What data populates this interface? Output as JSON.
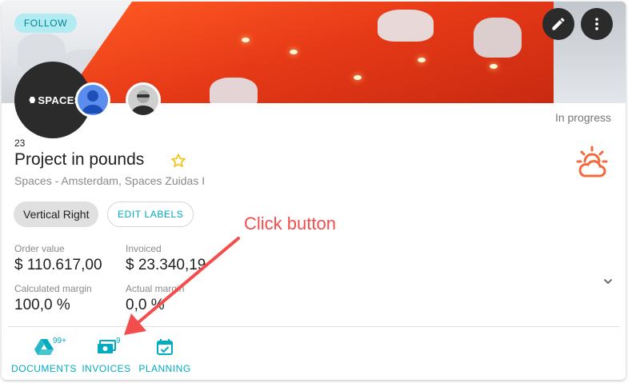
{
  "header": {
    "follow_label": "FOLLOW",
    "edit_icon": "pencil-icon",
    "more_icon": "more-vert-icon"
  },
  "logo": {
    "text": "SPACES"
  },
  "project": {
    "status": "In progress",
    "number": "23",
    "title": "Project in pounds",
    "subtitle": "Spaces - Amsterdam, Spaces Zuidas I",
    "favorite_icon": "star-outline-icon",
    "weather_icon": "sun-cloud-icon",
    "accent_color": "#f26a3d"
  },
  "labels": {
    "chip": "Vertical Right",
    "edit_label": "EDIT LABELS"
  },
  "metrics": {
    "order_value_label": "Order value",
    "order_value": "$ 110.617,00",
    "invoiced_label": "Invoiced",
    "invoiced": "$ 23.340,19",
    "calc_margin_label": "Calculated margin",
    "calc_margin": "100,0 %",
    "actual_margin_label": "Actual margin",
    "actual_margin": "0,0 %"
  },
  "actions": [
    {
      "label": "DOCUMENTS",
      "badge": "99+",
      "icon": "drive-icon"
    },
    {
      "label": "INVOICES",
      "badge": "9",
      "icon": "money-icon"
    },
    {
      "label": "PLANNING",
      "badge": "",
      "icon": "calendar-check-icon"
    }
  ],
  "annotation": {
    "text": "Click button",
    "color": "#f44d4d"
  },
  "colors": {
    "accent": "#00acc1",
    "follow_bg": "#b2ebf2"
  }
}
